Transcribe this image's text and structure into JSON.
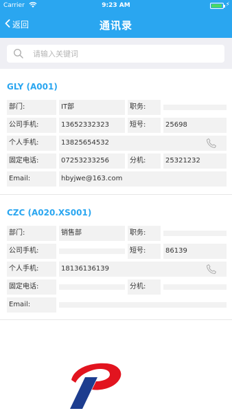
{
  "status_bar": {
    "carrier": "Carrier",
    "time": "9:23 AM"
  },
  "nav": {
    "back_label": "返回",
    "title": "通讯录"
  },
  "search": {
    "placeholder": "请输入关键词"
  },
  "contacts": [
    {
      "name": "GLY (A001)",
      "department_label": "部门:",
      "department": "IT部",
      "position_label": "职务:",
      "position": "",
      "company_mobile_label": "公司手机:",
      "company_mobile": "13652332323",
      "short_label": "短号:",
      "short": "25698",
      "personal_mobile_label": "个人手机:",
      "personal_mobile": "13825654532",
      "landline_label": "固定电话:",
      "landline": "07253233256",
      "extension_label": "分机:",
      "extension": "25321232",
      "email_label": "Email:",
      "email": "hbyjwe@163.com"
    },
    {
      "name": "CZC (A020.XS001)",
      "department_label": "部门:",
      "department": "销售部",
      "position_label": "职务:",
      "position": "",
      "company_mobile_label": "公司手机:",
      "company_mobile": "",
      "short_label": "短号:",
      "short": "86139",
      "personal_mobile_label": "个人手机:",
      "personal_mobile": "18136136139",
      "landline_label": "固定电话:",
      "landline": "",
      "extension_label": "分机:",
      "extension": "",
      "email_label": "Email:",
      "email": ""
    }
  ],
  "colors": {
    "accent": "#2aa6f0",
    "cell_bg": "#f2f2f2",
    "logo_red": "#e2141f",
    "logo_blue": "#1d3d8f"
  },
  "icons": [
    "chevron-left-icon",
    "wifi-icon",
    "battery-icon",
    "search-icon",
    "phone-icon",
    "logo-icon"
  ]
}
